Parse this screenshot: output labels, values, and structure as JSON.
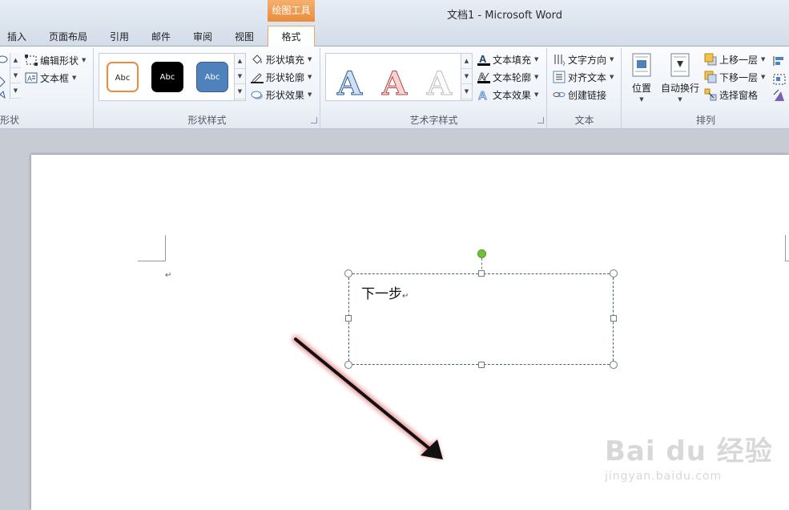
{
  "titlebar": {
    "context_tab": "绘图工具",
    "title": "文档1  -  Microsoft Word"
  },
  "tabs": [
    {
      "label": "插入"
    },
    {
      "label": "页面布局"
    },
    {
      "label": "引用"
    },
    {
      "label": "邮件"
    },
    {
      "label": "审阅"
    },
    {
      "label": "视图"
    },
    {
      "label": "格式",
      "active": true
    }
  ],
  "ribbon": {
    "insert_shapes": {
      "label": "形状",
      "edit_shape": "编辑形状",
      "text_box": "文本框"
    },
    "shape_styles": {
      "label": "形状样式",
      "swatches": [
        {
          "text": "Abc",
          "style": "orange-outline"
        },
        {
          "text": "Abc",
          "style": "black-fill"
        },
        {
          "text": "Abc",
          "style": "blue-fill"
        }
      ],
      "shape_fill": "形状填充",
      "shape_outline": "形状轮廓",
      "shape_effects": "形状效果"
    },
    "wordart_styles": {
      "label": "艺术字样式",
      "samples": [
        "A",
        "A",
        "A"
      ],
      "text_fill": "文本填充",
      "text_outline": "文本轮廓",
      "text_effects": "文本效果"
    },
    "text": {
      "label": "文本",
      "text_direction": "文字方向",
      "align_text": "对齐文本",
      "create_link": "创建链接"
    },
    "arrange": {
      "label": "排列",
      "position": "位置",
      "wrap_text": "自动换行",
      "bring_forward": "上移一层",
      "send_backward": "下移一层",
      "selection_pane": "选择窗格"
    }
  },
  "document": {
    "textbox_text": "下一步",
    "paragraph_mark": "↵"
  },
  "watermark": {
    "brand": "Bai du 经验",
    "url": "jingyan.baidu.com"
  },
  "colors": {
    "context_tab": "#ea8c3c",
    "rotate_handle": "#6ec23a",
    "arrow": "#111111",
    "arrow_glow": "#e27a7a"
  }
}
